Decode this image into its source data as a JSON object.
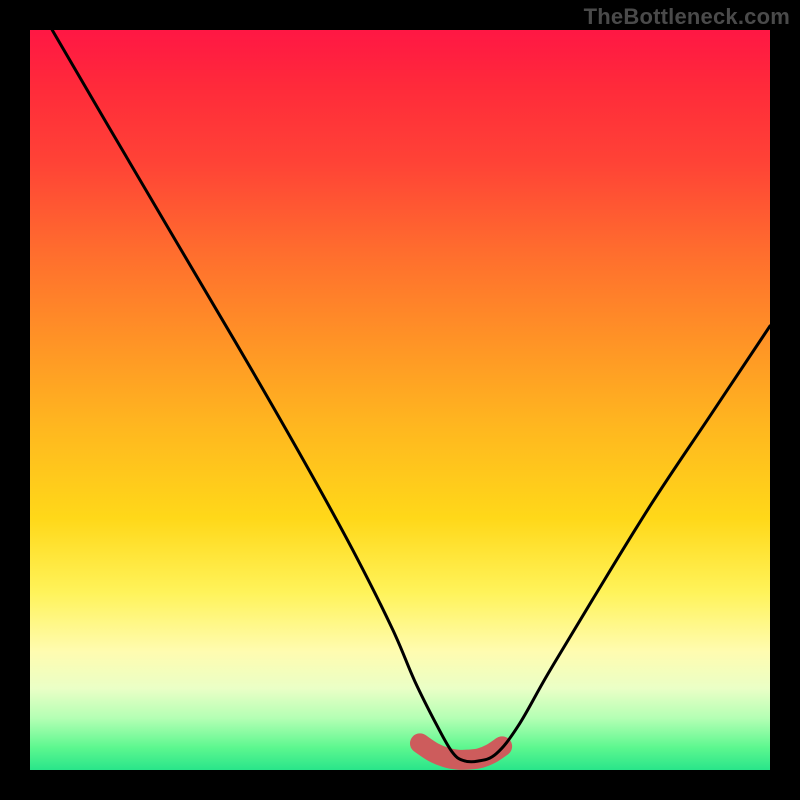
{
  "attribution": "TheBottleneck.com",
  "chart_data": {
    "type": "line",
    "title": "",
    "xlabel": "",
    "ylabel": "",
    "xlim": [
      0,
      100
    ],
    "ylim": [
      0,
      100
    ],
    "series": [
      {
        "name": "bottleneck-curve",
        "x": [
          3,
          10,
          20,
          30,
          38,
          44,
          49,
          52,
          55,
          57,
          58.5,
          60.5,
          63,
          66,
          70,
          76,
          84,
          92,
          100
        ],
        "values": [
          100,
          88,
          71,
          54,
          40,
          29,
          19,
          12,
          6,
          2.5,
          1.3,
          1.2,
          2.2,
          6,
          13,
          23,
          36,
          48,
          60
        ]
      }
    ],
    "annotations": [
      {
        "name": "thick-bottom-segment",
        "x": [
          52.7,
          54.5,
          56.2,
          57.8,
          59.2,
          60.8,
          62.3,
          63.8
        ],
        "values": [
          3.6,
          2.4,
          1.7,
          1.4,
          1.4,
          1.6,
          2.2,
          3.2
        ]
      }
    ],
    "colors": {
      "curve": "#000000",
      "thick_segment": "#cd5c5c"
    }
  }
}
